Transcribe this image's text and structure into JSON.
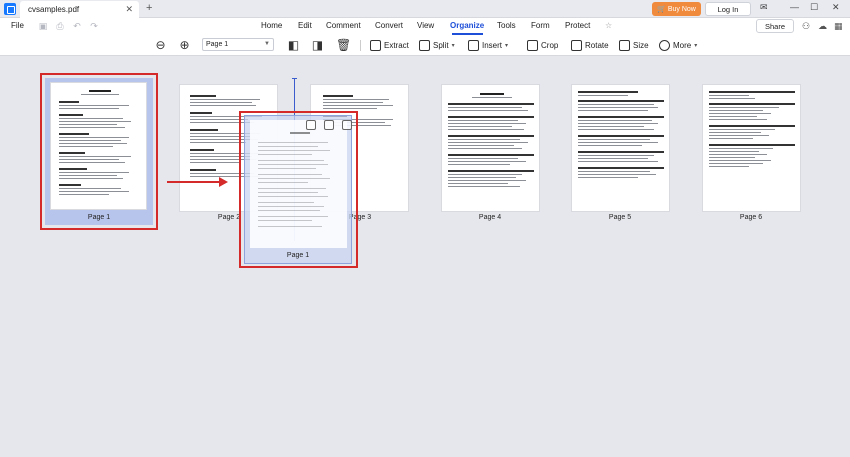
{
  "titlebar": {
    "tab_title": "cvsamples.pdf",
    "tab_close": "✕",
    "new_tab": "+",
    "buy_now": "Buy Now",
    "login": "Log In",
    "minimize": "—",
    "maximize": "☐",
    "close": "✕"
  },
  "menubar": {
    "file": "File",
    "items": [
      "Home",
      "Edit",
      "Comment",
      "Convert",
      "View",
      "Organize",
      "Tools",
      "Form",
      "Protect"
    ],
    "active": "Organize",
    "share": "Share"
  },
  "toolbar": {
    "page_select": "Page 1",
    "extract": "Extract",
    "split": "Split",
    "insert": "Insert",
    "crop": "Crop",
    "rotate": "Rotate",
    "size": "Size",
    "more": "More"
  },
  "pages": [
    {
      "label": "Page 1",
      "selected": true
    },
    {
      "label": "Page 2",
      "selected": false
    },
    {
      "label": "Page 3",
      "selected": false
    },
    {
      "label": "Page 4",
      "selected": false
    },
    {
      "label": "Page 5",
      "selected": false
    },
    {
      "label": "Page 6",
      "selected": false
    }
  ],
  "drag_ghost_label": "Page 1",
  "colors": {
    "accent": "#1e4fd8",
    "highlight": "#d42a2a",
    "buy_now": "#f08a3c",
    "selection_fill": "#b7c4eb"
  }
}
